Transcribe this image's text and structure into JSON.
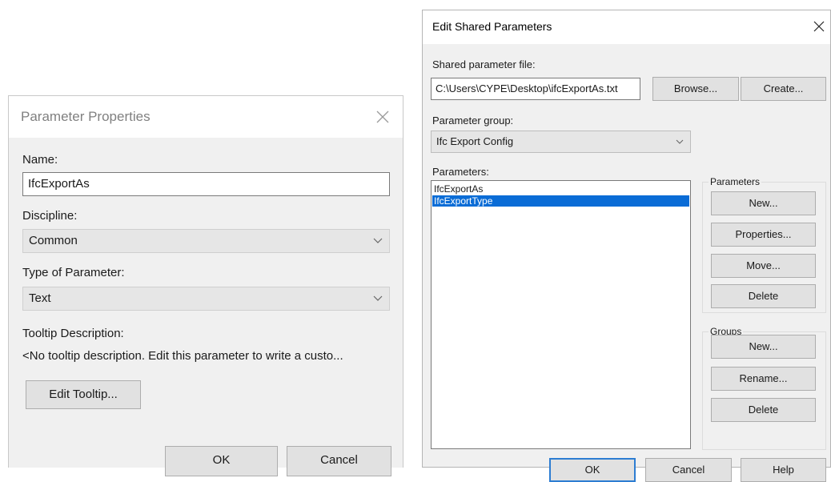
{
  "param_props": {
    "title": "Parameter Properties",
    "name_label": "Name:",
    "name_value": "IfcExportAs",
    "discipline_label": "Discipline:",
    "discipline_value": "Common",
    "type_label": "Type of Parameter:",
    "type_value": "Text",
    "tooltip_label": "Tooltip Description:",
    "tooltip_text": "<No tooltip description. Edit this parameter to write a custo...",
    "edit_tooltip_button": "Edit Tooltip...",
    "ok_button": "OK",
    "cancel_button": "Cancel"
  },
  "shared_params": {
    "title": "Edit Shared Parameters",
    "file_label": "Shared parameter file:",
    "file_path": "C:\\Users\\CYPE\\Desktop\\ifcExportAs.txt",
    "browse_button": "Browse...",
    "create_button": "Create...",
    "group_label": "Parameter group:",
    "group_value": "Ifc Export Config",
    "parameters_label": "Parameters:",
    "parameters": [
      {
        "name": "IfcExportAs",
        "selected": false
      },
      {
        "name": "IfcExportType",
        "selected": true
      }
    ],
    "parameters_group": {
      "title": "Parameters",
      "new_button": "New...",
      "properties_button": "Properties...",
      "move_button": "Move...",
      "delete_button": "Delete"
    },
    "groups_group": {
      "title": "Groups",
      "new_button": "New...",
      "rename_button": "Rename...",
      "delete_button": "Delete"
    },
    "ok_button": "OK",
    "cancel_button": "Cancel",
    "help_button": "Help"
  },
  "colors": {
    "selection": "#0a6cd6",
    "default_button_border": "#2d7dd2",
    "dialog_bg": "#f0f0f0"
  }
}
